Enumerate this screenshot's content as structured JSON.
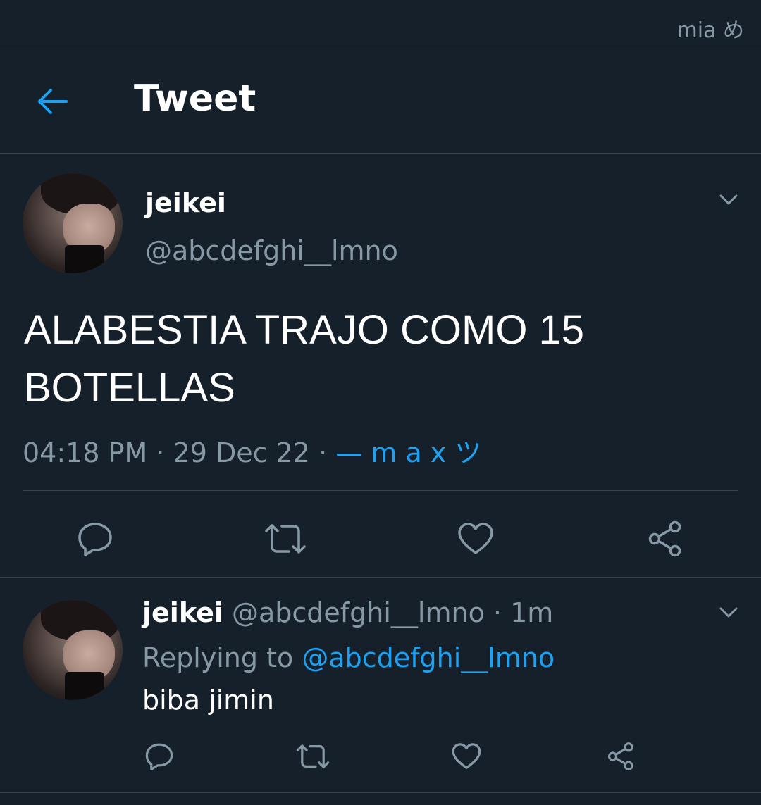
{
  "status_bar": {
    "text": "mia め"
  },
  "header": {
    "title": "Tweet",
    "back_icon": "arrow-left-icon",
    "accent": "#1da1f2"
  },
  "main_tweet": {
    "display_name": "jeikei",
    "handle": "@abcdefghi__lmno",
    "text": "ALABESTIA TRAJO COMO 15 BOTELLAS",
    "time": "04:18 PM",
    "date": "29 Dec 22",
    "separator": "·",
    "source": "— m a x ツ",
    "actions": [
      "reply-icon",
      "retweet-icon",
      "like-icon",
      "share-icon"
    ]
  },
  "reply_tweet": {
    "display_name": "jeikei",
    "handle": "@abcdefghi__lmno",
    "time_ago": "1m",
    "separator": "·",
    "replying_prefix": "Replying to",
    "replying_to": "@abcdefghi__lmno",
    "text": "biba jimin",
    "actions": [
      "reply-icon",
      "retweet-icon",
      "like-icon",
      "share-icon"
    ]
  },
  "colors": {
    "background": "#15202b",
    "divider": "#38444d",
    "secondary_text": "#8899a6",
    "link": "#1da1f2"
  }
}
